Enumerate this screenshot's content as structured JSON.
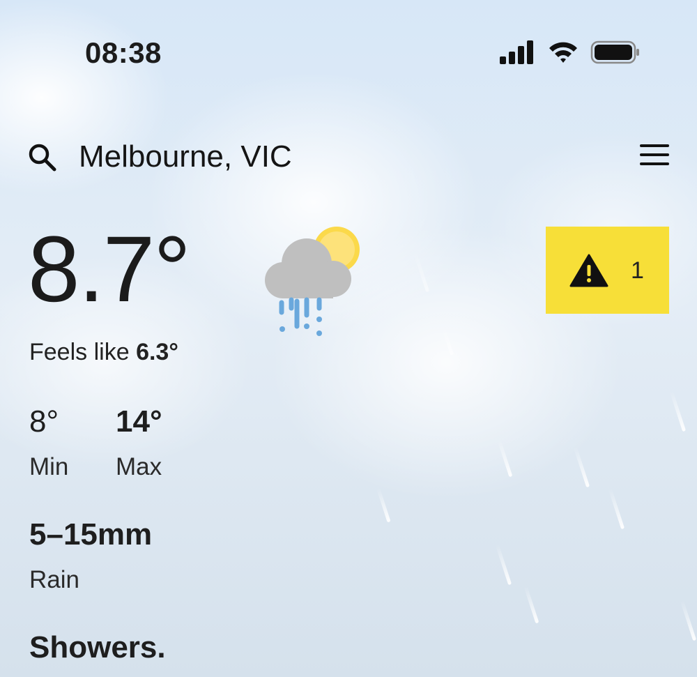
{
  "status_bar": {
    "time": "08:38",
    "signal_icon": "cellular-signal-icon",
    "wifi_icon": "wifi-icon",
    "battery_icon": "battery-icon"
  },
  "header": {
    "search_icon": "search-icon",
    "location": "Melbourne, VIC",
    "menu_icon": "hamburger-menu-icon"
  },
  "current": {
    "temperature": "8.7°",
    "feels_like_label": "Feels like",
    "feels_like_value": "6.3°",
    "condition_icon": "rain-showers-partly-sunny-icon"
  },
  "warnings": {
    "icon": "warning-triangle-icon",
    "count": "1",
    "color": "#f7df38"
  },
  "forecast": {
    "min_value": "8°",
    "min_label": "Min",
    "max_value": "14°",
    "max_label": "Max",
    "rain_value": "5–15mm",
    "rain_label": "Rain",
    "summary": "Showers."
  }
}
